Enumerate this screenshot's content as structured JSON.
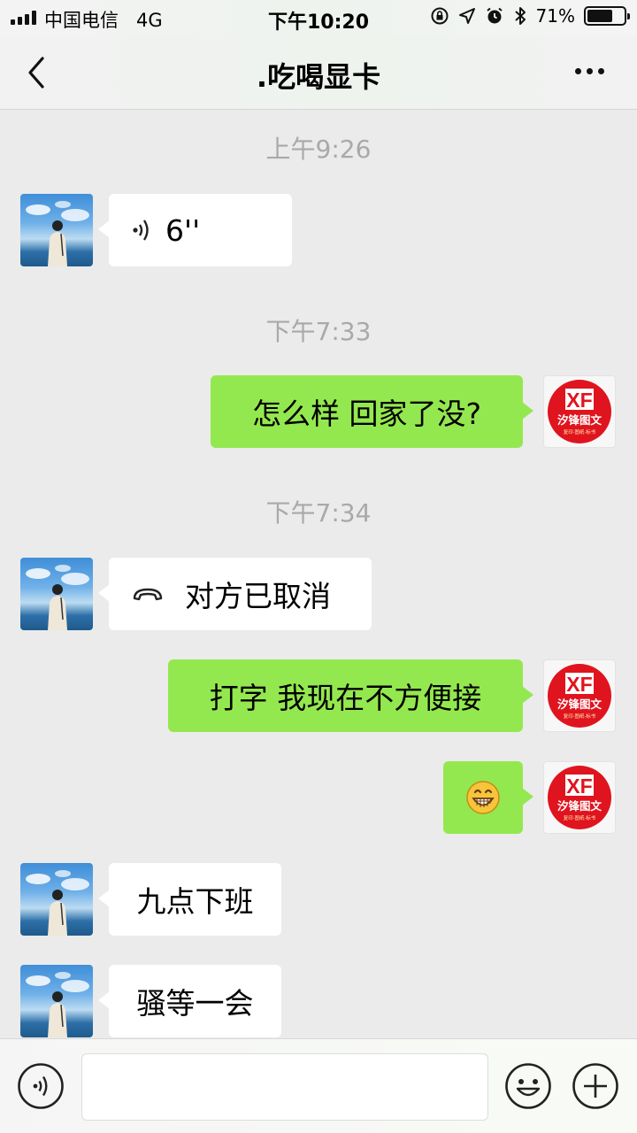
{
  "status_bar": {
    "carrier": "中国电信",
    "network": "4G",
    "time": "下午10:20",
    "battery_percent": "71%",
    "battery_level": 0.71
  },
  "nav": {
    "title": ".吃喝显卡",
    "back_icon": "chevron-left-icon",
    "more_icon": "more-dots-icon"
  },
  "timestamps": [
    "上午9:26",
    "下午7:33",
    "下午7:34"
  ],
  "messages": [
    {
      "side": "left",
      "type": "voice",
      "text": "6''",
      "icon": "voice-icon"
    },
    {
      "side": "right",
      "type": "text",
      "text": "怎么样 回家了没?"
    },
    {
      "side": "left",
      "type": "call",
      "text": "对方已取消",
      "icon": "phone-hangup-icon"
    },
    {
      "side": "right",
      "type": "text",
      "text": "打字  我现在不方便接"
    },
    {
      "side": "right",
      "type": "emoji",
      "text": "",
      "icon": "grin-emoji-icon"
    },
    {
      "side": "left",
      "type": "text",
      "text": "九点下班"
    },
    {
      "side": "left",
      "type": "text",
      "text": "骚等一会"
    }
  ],
  "avatar_logo": {
    "line1": "XF",
    "line2": "汐锋图文",
    "line3": "复印·图纸·标书"
  },
  "colors": {
    "background": "#ebebeb",
    "bubble_sent": "#94e84f",
    "bubble_received": "#ffffff",
    "timestamp_text": "#a9a9a9",
    "logo_red": "#e0141e"
  },
  "input_bar": {
    "voice_icon": "voice-input-icon",
    "emoji_icon": "emoji-smile-icon",
    "plus_icon": "plus-circle-icon",
    "placeholder": ""
  }
}
